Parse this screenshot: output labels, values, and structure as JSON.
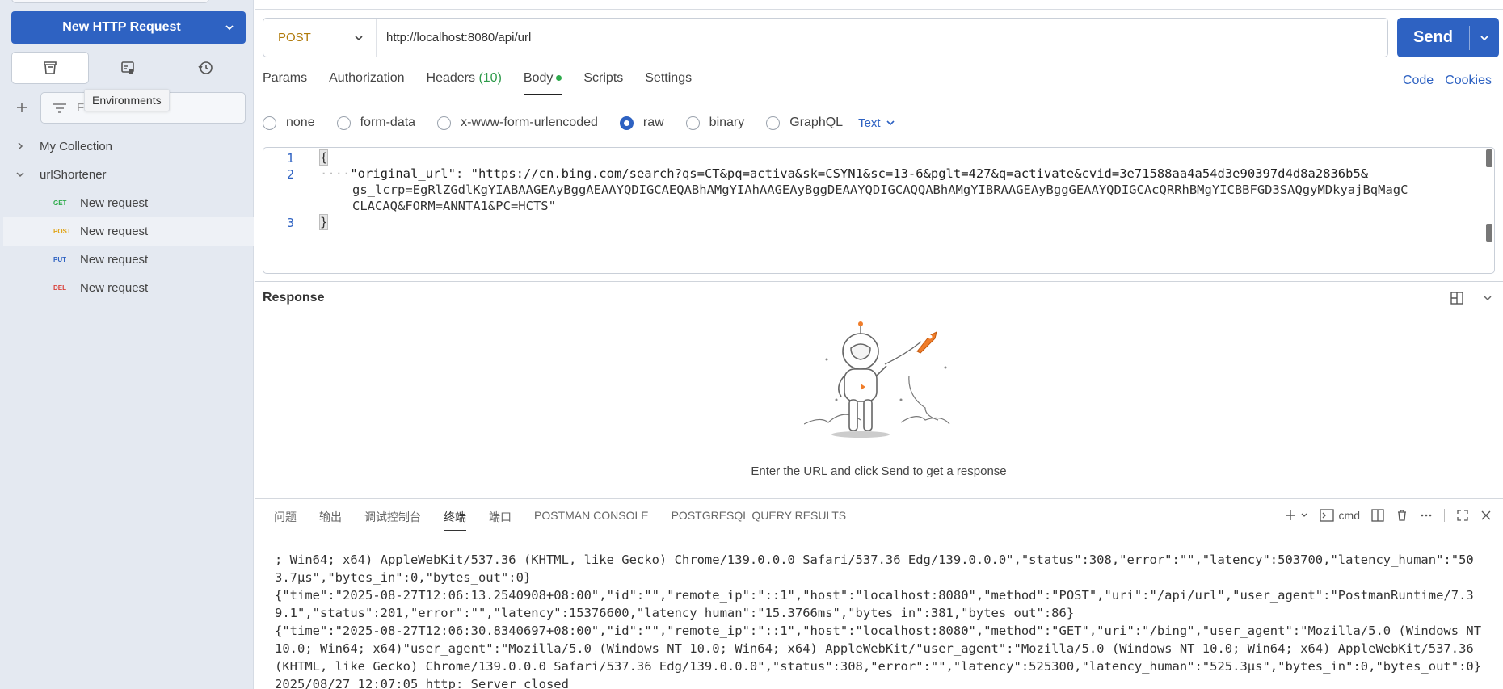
{
  "sidebar": {
    "new_request_label": "New HTTP Request",
    "icon_tabs": [
      {
        "icon": "collections-icon"
      },
      {
        "icon": "environments-icon"
      },
      {
        "icon": "history-icon"
      }
    ],
    "tooltip": "Environments",
    "filter_placeholder": "F",
    "collections": [
      {
        "name": "My Collection",
        "expanded": false
      },
      {
        "name": "urlShortener",
        "expanded": true
      }
    ],
    "requests": [
      {
        "method": "GET",
        "name": "New request",
        "color": "#2eab4c"
      },
      {
        "method": "POST",
        "name": "New request",
        "color": "#e0a416"
      },
      {
        "method": "PUT",
        "name": "New request",
        "color": "#2e62c2"
      },
      {
        "method": "DEL",
        "name": "New request",
        "color": "#d9403a"
      }
    ]
  },
  "request": {
    "method": "POST",
    "url": "http://localhost:8080/api/url",
    "send_label": "Send",
    "tabs": {
      "params": "Params",
      "authorization": "Authorization",
      "headers": "Headers",
      "headers_count": "(10)",
      "body": "Body",
      "scripts": "Scripts",
      "settings": "Settings"
    },
    "links": {
      "code": "Code",
      "cookies": "Cookies"
    },
    "body_types": {
      "none": "none",
      "form_data": "form-data",
      "urlencoded": "x-www-form-urlencoded",
      "raw": "raw",
      "binary": "binary",
      "graphql": "GraphQL",
      "format": "Text"
    },
    "editor": {
      "line_numbers": [
        "1",
        "2",
        "3"
      ],
      "open_brace": "{",
      "close_brace": "}",
      "key": "\"original_url\"",
      "value_line1": "\"https://cn.bing.com/search?qs=CT&pq=activa&sk=CSYN1&sc=13-6&pglt=427&q=activate&cvid=3e71588aa4a54d3e90397d4d8a2836b5&",
      "value_line2": "gs_lcrp=EgRlZGdlKgYIABAAGEAyBggAEAAYQDIGCAEQABhAMgYIAhAAGEAyBggDEAAYQDIGCAQQABhAMgYIBRAAGEAyBggGEAAYQDIGCAcQRRhBMgYICBBFGD3SAQgyMDkyajBqMagC",
      "value_line3": "CLACAQ&FORM=ANNTA1&PC=HCTS\""
    }
  },
  "response": {
    "title": "Response",
    "empty_message": "Enter the URL and click Send to get a response"
  },
  "panel": {
    "tabs": [
      "问题",
      "输出",
      "调试控制台",
      "终端",
      "端口",
      "POSTMAN CONSOLE",
      "POSTGRESQL QUERY RESULTS"
    ],
    "active_tab": "终端",
    "shell": "cmd",
    "terminal_lines": [
      "; Win64; x64) AppleWebKit/537.36 (KHTML, like Gecko) Chrome/139.0.0.0 Safari/537.36 Edg/139.0.0.0\",\"status\":308,\"error\":\"\",\"latency\":503700,\"latency_human\":\"503.7µs\",\"bytes_in\":0,\"bytes_out\":0}",
      "{\"time\":\"2025-08-27T12:06:13.2540908+08:00\",\"id\":\"\",\"remote_ip\":\"::1\",\"host\":\"localhost:8080\",\"method\":\"POST\",\"uri\":\"/api/url\",\"user_agent\":\"PostmanRuntime/7.39.1\",\"status\":201,\"error\":\"\",\"latency\":15376600,\"latency_human\":\"15.3766ms\",\"bytes_in\":381,\"bytes_out\":86}",
      "{\"time\":\"2025-08-27T12:06:30.8340697+08:00\",\"id\":\"\",\"remote_ip\":\"::1\",\"host\":\"localhost:8080\",\"method\":\"GET\",\"uri\":\"/bing\",\"user_agent\":\"Mozilla/5.0 (Windows NT 10.0; Win64; x64)\"user_agent\":\"Mozilla/5.0 (Windows NT 10.0; Win64; x64) AppleWebKit/\"user_agent\":\"Mozilla/5.0 (Windows NT 10.0; Win64; x64) AppleWebKit/537.36 (KHTML, like Gecko) Chrome/139.0.0.0 Safari/537.36 Edg/139.0.0.0\",\"status\":308,\"error\":\"\",\"latency\":525300,\"latency_human\":\"525.3µs\",\"bytes_in\":0,\"bytes_out\":0}",
      "2025/08/27 12:07:05 http: Server closed"
    ]
  },
  "colors": {
    "accent": "#2e62c2",
    "sidebar_bg": "#e4e9f1"
  }
}
